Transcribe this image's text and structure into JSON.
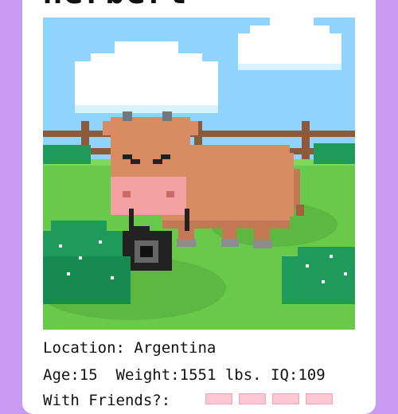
{
  "card": {
    "name": "Herbert",
    "location_label": "Location:",
    "location_value": "Argentina",
    "age_label": "Age:",
    "age_value": "15",
    "weight_label": "Weight:",
    "weight_value": "1551 lbs.",
    "iq_label": "IQ:",
    "iq_value": "109",
    "third_row_label": "With Friends?:",
    "hearts_visible": 4
  },
  "colors": {
    "background": "#c89bf0",
    "card": "#ffffff",
    "sky": "#8fd3ff",
    "grass": "#68c94a",
    "cow": "#d98b63",
    "snout": "#f4a0a0",
    "fence": "#8b5a3c",
    "bush": "#1f9a5b",
    "heart": "#ffc7d3"
  },
  "icons": {
    "animal": "cow-icon",
    "camera": "camera-icon",
    "bush": "bush-icon",
    "cloud": "cloud-icon"
  }
}
